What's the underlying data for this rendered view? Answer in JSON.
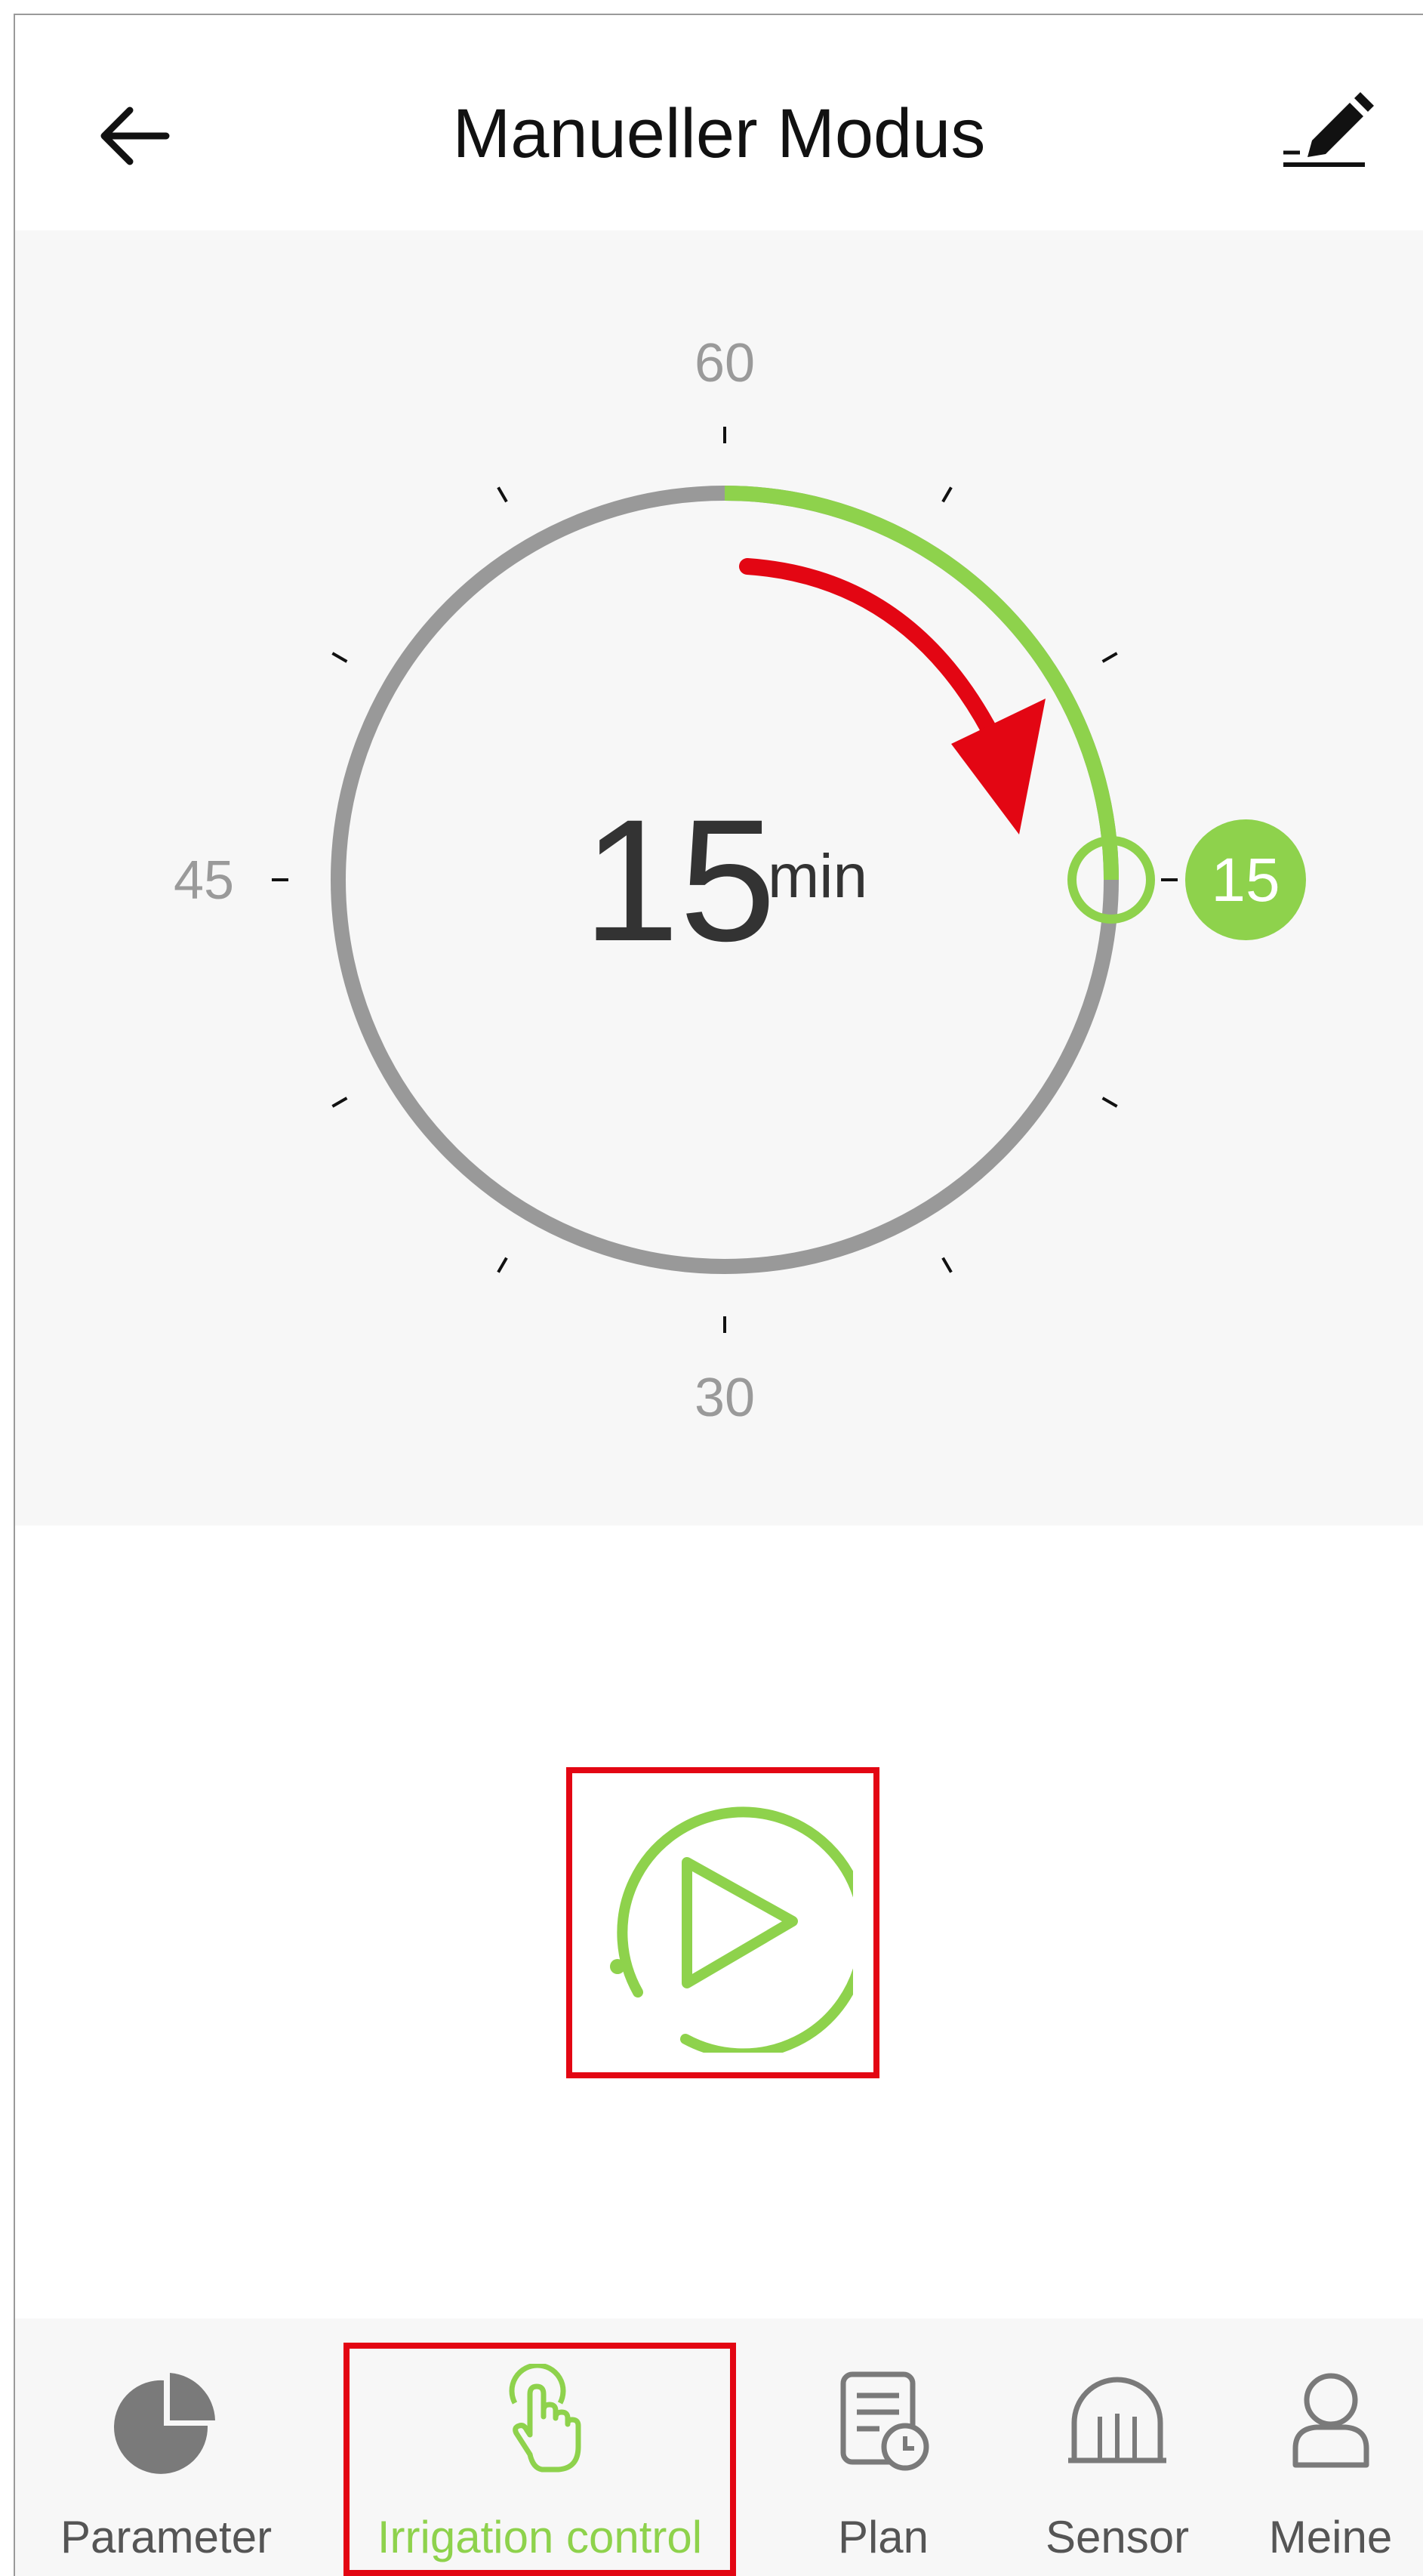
{
  "header": {
    "back_icon": "arrow-left-icon",
    "title": "Manueller Modus",
    "edit_icon": "pencil-icon"
  },
  "dial": {
    "labels": {
      "top": "60",
      "left": "45",
      "bottom": "30"
    },
    "value": "15",
    "unit": "min",
    "badge_value": "15",
    "selected_minutes": 15,
    "max_minutes": 60,
    "colors": {
      "track": "#999999",
      "progress": "#8ed24c",
      "annotation_arrow": "#e30613"
    }
  },
  "play": {
    "icon": "play-icon",
    "color": "#8ed24c",
    "highlight_color": "#e30613"
  },
  "tabbar": {
    "tabs": [
      {
        "label": "Parameter",
        "icon": "pie-chart-icon",
        "active": false
      },
      {
        "label": "Irrigation control",
        "icon": "tap-hand-icon",
        "active": true
      },
      {
        "label": "Plan",
        "icon": "schedule-icon",
        "active": false
      },
      {
        "label": "Sensor",
        "icon": "sensor-icon",
        "active": false
      },
      {
        "label": "Meine",
        "icon": "user-icon",
        "active": false
      }
    ]
  }
}
